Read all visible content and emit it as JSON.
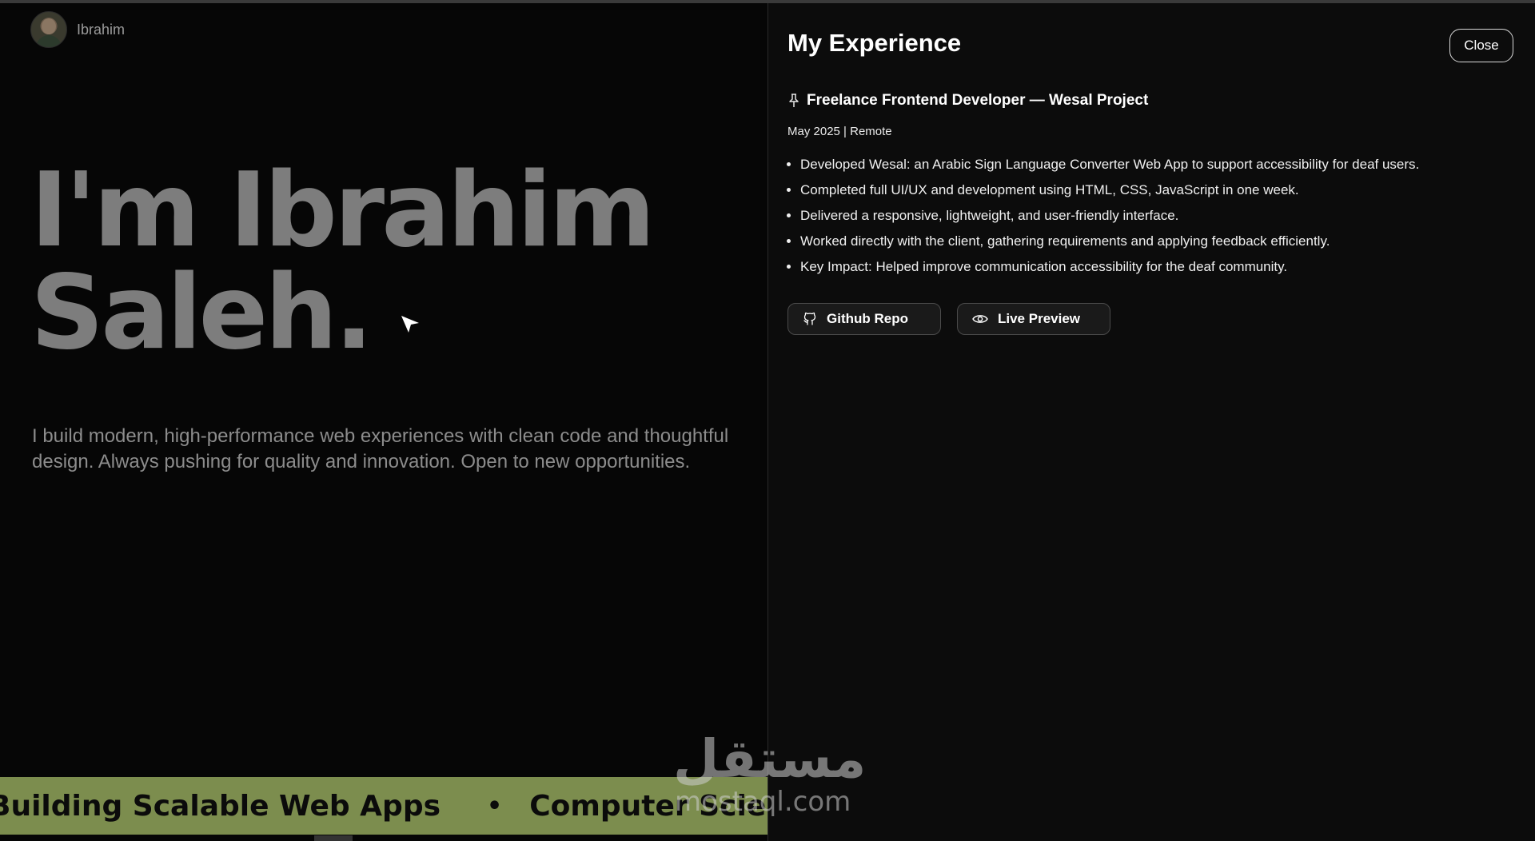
{
  "header": {
    "name": "Ibrahim"
  },
  "hero": {
    "title_line1": "I'm Ibrahim",
    "title_line2": "Saleh.",
    "subtitle": "I build modern, high-performance web experiences with clean code and  thoughtful design. Always pushing for quality and innovation. Open to new opportunities."
  },
  "marquee": {
    "item1": "Building Scalable Web Apps",
    "separator": "•",
    "item2": "Computer Science"
  },
  "panel": {
    "title": "My Experience",
    "close_label": "Close",
    "job": {
      "title": "Freelance Frontend Developer — Wesal Project",
      "meta": "May 2025 | Remote",
      "bullets": [
        "Developed Wesal: an Arabic Sign Language Converter Web App to support accessibility for deaf users.",
        "Completed full UI/UX and development using HTML, CSS, JavaScript in one week.",
        "Delivered a responsive, lightweight, and user-friendly interface.",
        "Worked directly with the client, gathering requirements and applying feedback efficiently.",
        "Key Impact: Helped improve communication accessibility for the deaf community."
      ]
    },
    "actions": {
      "github_label": "Github Repo",
      "preview_label": "Live Preview"
    }
  },
  "watermark": {
    "arabic": "مستقل",
    "latin": "mostaql.com"
  },
  "icons": {
    "pin": "pin-icon",
    "github": "github-icon",
    "eye": "eye-icon",
    "cursor": "cursor-icon"
  },
  "colors": {
    "background": "#060606",
    "panel": "#0c0c0c",
    "marquee": "#7c8d4e",
    "hero_text": "#7d7d7d"
  }
}
